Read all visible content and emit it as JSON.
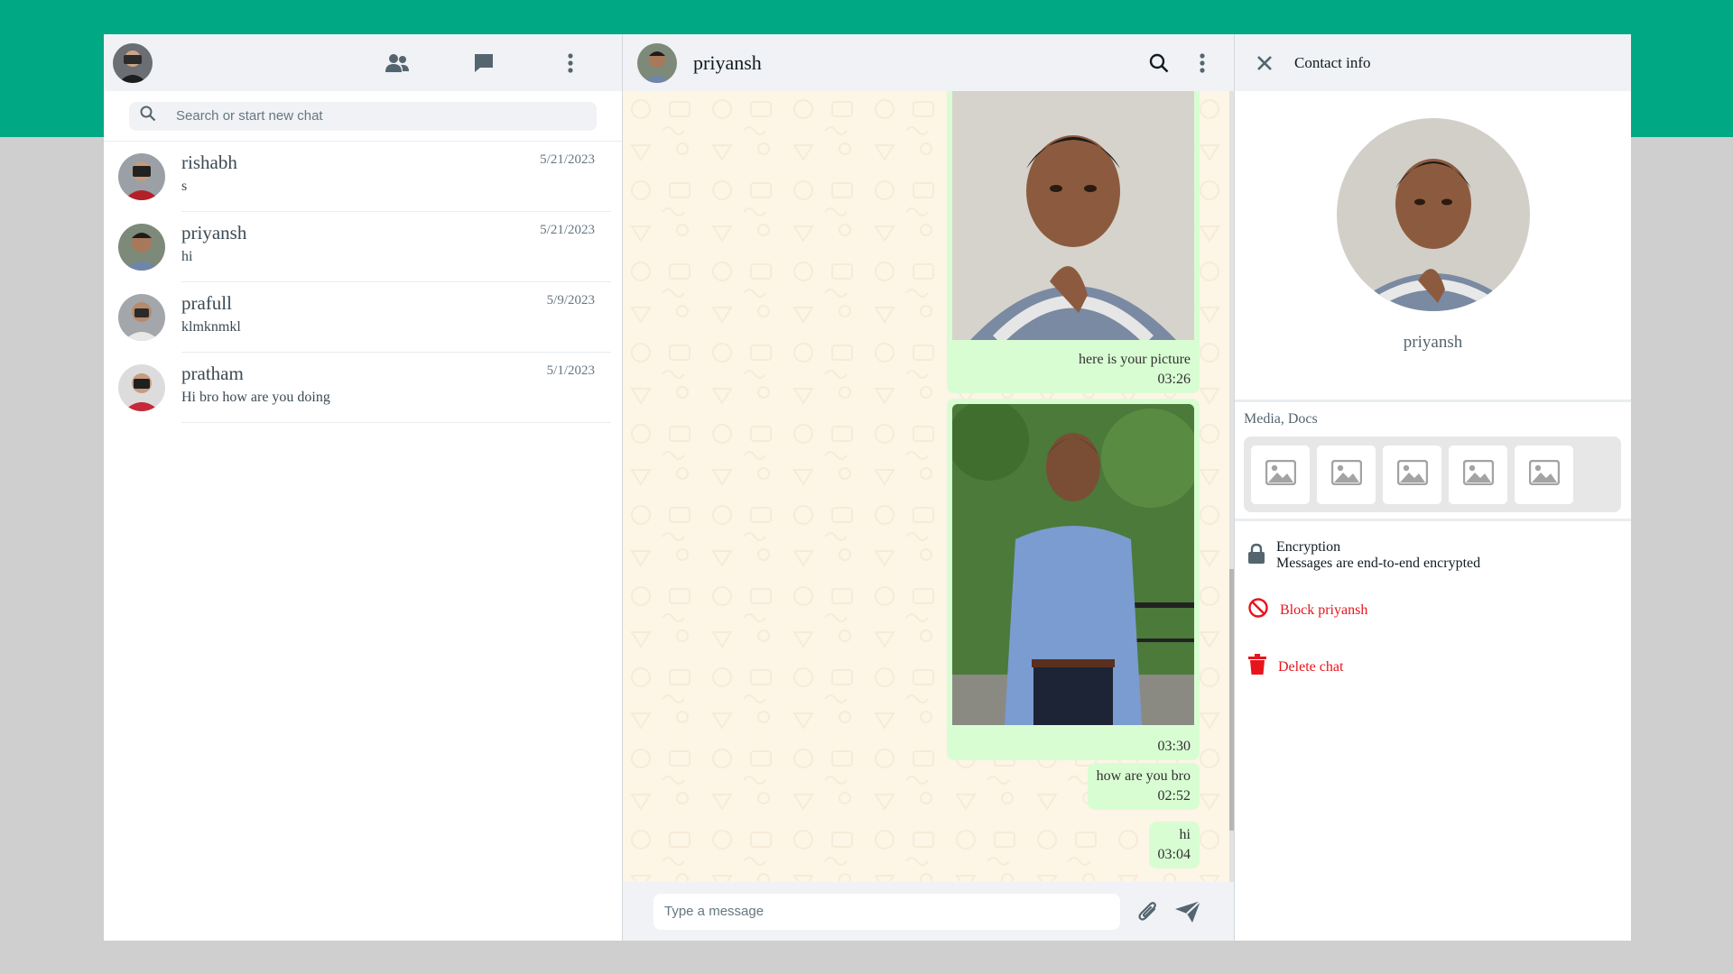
{
  "left_header": {
    "icons": [
      "community-icon",
      "chat-icon",
      "menu-dots-icon"
    ]
  },
  "search": {
    "placeholder": "Search or start new chat"
  },
  "chats": [
    {
      "name": "rishabh",
      "preview": "s",
      "date": "5/21/2023"
    },
    {
      "name": "priyansh",
      "preview": "hi",
      "date": "5/21/2023"
    },
    {
      "name": "prafull",
      "preview": "klmknmkl",
      "date": "5/9/2023"
    },
    {
      "name": "pratham",
      "preview": "Hi bro how are you doing",
      "date": "5/1/2023"
    }
  ],
  "conversation": {
    "title": "priyansh",
    "messages": [
      {
        "type": "image",
        "caption": "here is your picture",
        "time": "03:26"
      },
      {
        "type": "image",
        "caption": "",
        "time": "03:30"
      },
      {
        "type": "text",
        "text": "how are you bro",
        "time": "02:52"
      },
      {
        "type": "text",
        "text": "hi",
        "time": "03:04"
      }
    ],
    "composer_placeholder": "Type a message"
  },
  "contact_info": {
    "title": "Contact info",
    "name": "priyansh",
    "media_label": "Media, Docs",
    "media_count": 5,
    "encryption_title": "Encryption",
    "encryption_subtitle": "Messages are end-to-end encrypted",
    "block_label": "Block priyansh",
    "delete_label": "Delete chat"
  },
  "colors": {
    "brand": "#00a884",
    "bubble": "#d9fdd3",
    "chat_bg": "#fdf5e6",
    "danger": "#e8141c"
  }
}
